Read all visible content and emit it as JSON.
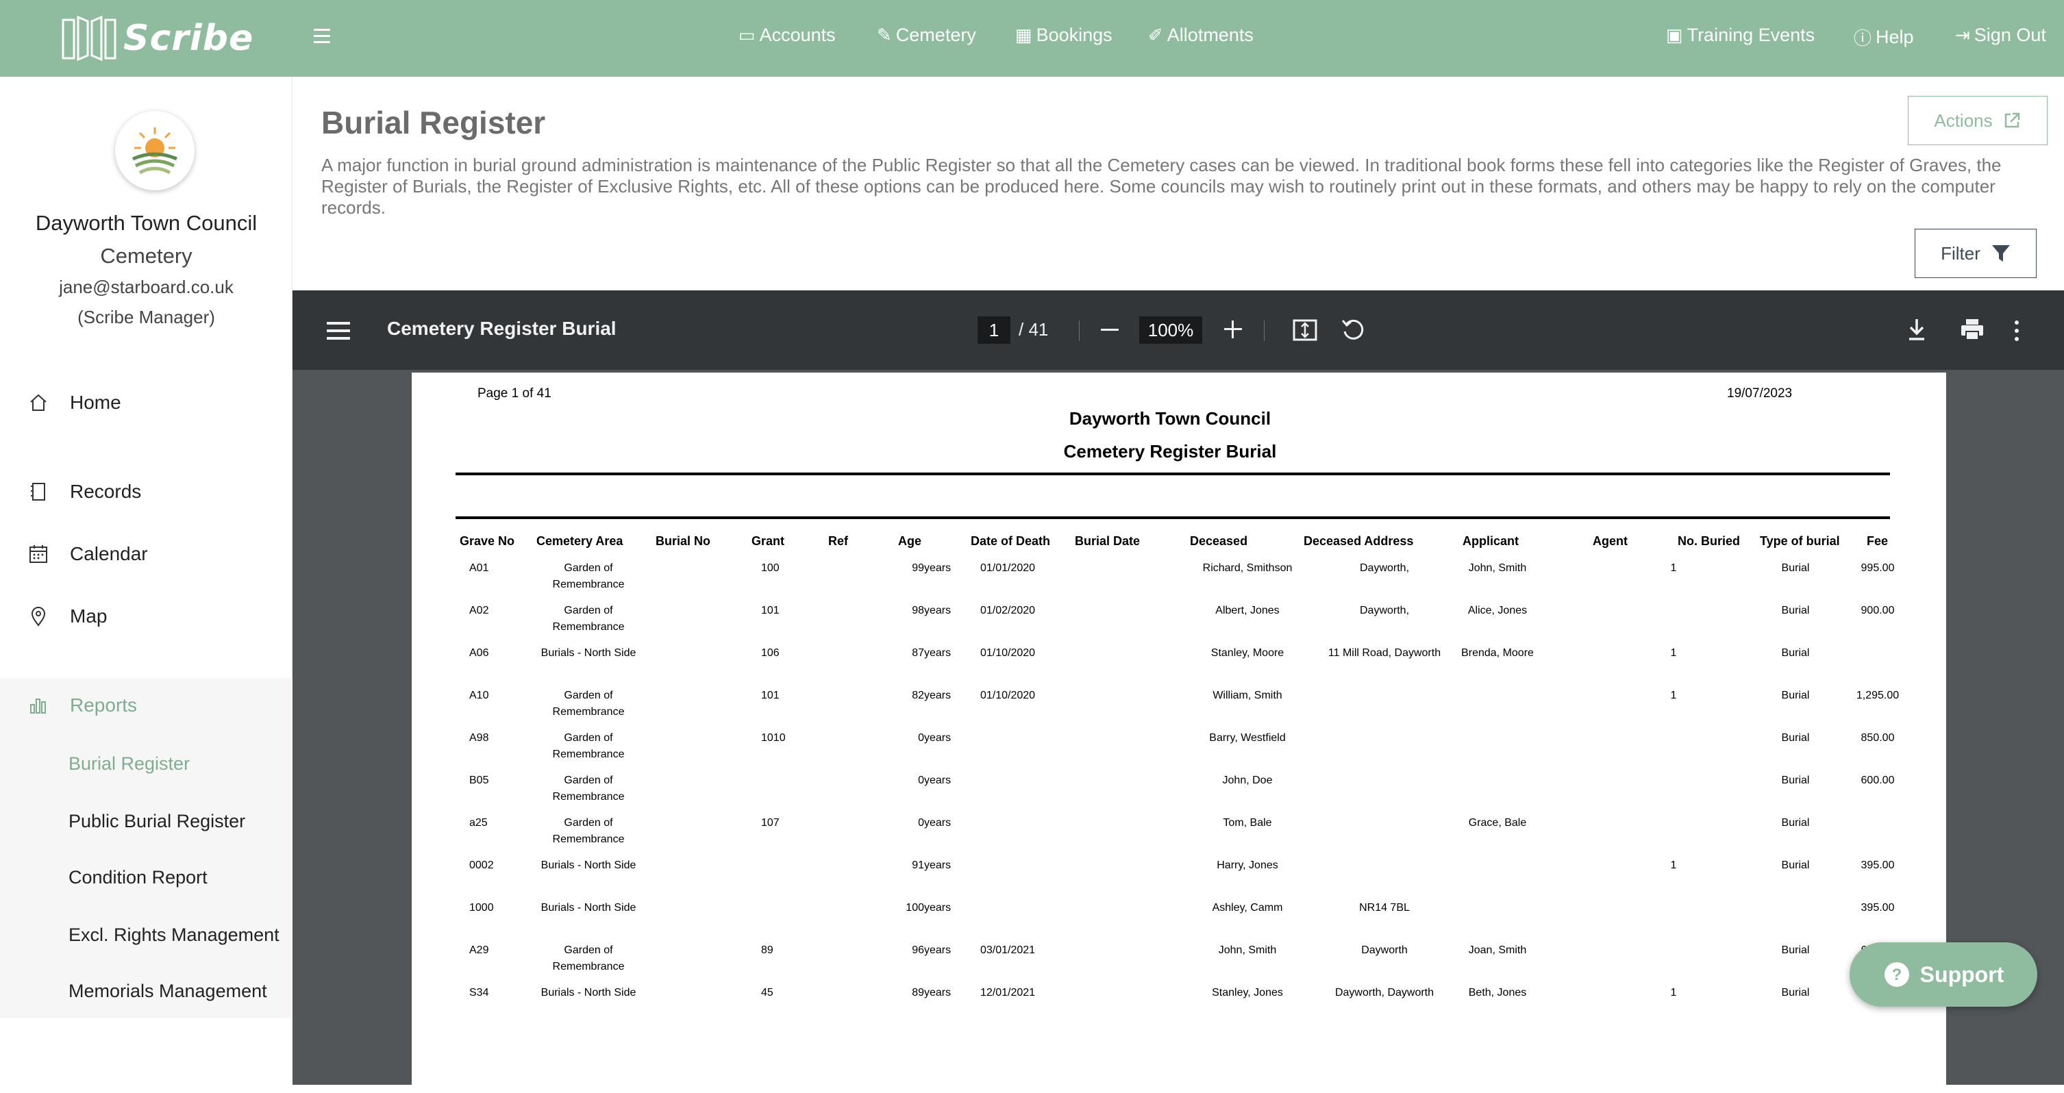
{
  "brand": {
    "name": "Scribe"
  },
  "topnav": {
    "accounts": "Accounts",
    "cemetery": "Cemetery",
    "bookings": "Bookings",
    "allotments": "Allotments",
    "training": "Training Events",
    "help": "Help",
    "signout": "Sign Out"
  },
  "org": {
    "name": "Dayworth Town Council",
    "module": "Cemetery",
    "email": "jane@starboard.co.uk",
    "role": "(Scribe Manager)"
  },
  "sidebar": {
    "home": "Home",
    "records": "Records",
    "calendar": "Calendar",
    "map": "Map",
    "reports": "Reports",
    "sub": [
      "Burial Register",
      "Public Burial Register",
      "Condition Report",
      "Excl. Rights Management",
      "Memorials Management"
    ]
  },
  "page": {
    "title": "Burial Register",
    "description": "A major function in burial ground administration is maintenance of the Public Register so that all the Cemetery cases can be viewed. In traditional book forms these fell into categories like the Register of Graves, the Register of Burials, the Register of Exclusive Rights, etc. All of these options can be produced here. Some councils may wish to routinely print out in these formats, and others may be happy to rely on the computer records.",
    "actions_label": "Actions",
    "filter_label": "Filter"
  },
  "viewer": {
    "title": "Cemetery Register Burial",
    "page_current": "1",
    "page_total": "/ 41",
    "zoom": "100%"
  },
  "report": {
    "page_label": "Page 1 of 41",
    "date": "19/07/2023",
    "title": "Dayworth Town Council",
    "subtitle": "Cemetery Register Burial",
    "columns": [
      "Grave No",
      "Cemetery Area",
      "Burial No",
      "Grant",
      "Ref",
      "Age",
      "Date of Death",
      "Burial Date",
      "Deceased",
      "Deceased Address",
      "Applicant",
      "Agent",
      "No. Buried",
      "Type of burial",
      "Fee"
    ],
    "rows": [
      {
        "grave": "A01",
        "area1": "Garden of",
        "area2": "Remembrance",
        "grant": "100",
        "age": "99",
        "unit": "years",
        "dod": "01/01/2020",
        "deceased": "Richard, Smithson",
        "address": "Dayworth,",
        "applicant": "John, Smith",
        "buried": "1",
        "type": "Burial",
        "fee": "995.00"
      },
      {
        "grave": "A02",
        "area1": "Garden of",
        "area2": "Remembrance",
        "grant": "101",
        "age": "98",
        "unit": "years",
        "dod": "01/02/2020",
        "deceased": "Albert, Jones",
        "address": "Dayworth,",
        "applicant": "Alice, Jones",
        "buried": "",
        "type": "Burial",
        "fee": "900.00"
      },
      {
        "grave": "A06",
        "area1": "Burials - North Side",
        "area2": "",
        "grant": "106",
        "age": "87",
        "unit": "years",
        "dod": "01/10/2020",
        "deceased": "Stanley, Moore",
        "address": "11 Mill Road, Dayworth",
        "applicant": "Brenda, Moore",
        "buried": "1",
        "type": "Burial",
        "fee": ""
      },
      {
        "grave": "A10",
        "area1": "Garden of",
        "area2": "Remembrance",
        "grant": "101",
        "age": "82",
        "unit": "years",
        "dod": "01/10/2020",
        "deceased": "William, Smith",
        "address": "",
        "applicant": "",
        "buried": "1",
        "type": "Burial",
        "fee": "1,295.00"
      },
      {
        "grave": "A98",
        "area1": "Garden of",
        "area2": "Remembrance",
        "grant": "1010",
        "age": "0",
        "unit": "years",
        "dod": "",
        "deceased": "Barry, Westfield",
        "address": "",
        "applicant": "",
        "buried": "",
        "type": "Burial",
        "fee": "850.00"
      },
      {
        "grave": "B05",
        "area1": "Garden of",
        "area2": "Remembrance",
        "grant": "",
        "age": "0",
        "unit": "years",
        "dod": "",
        "deceased": "John, Doe",
        "address": "",
        "applicant": "",
        "buried": "",
        "type": "Burial",
        "fee": "600.00"
      },
      {
        "grave": "a25",
        "area1": "Garden of",
        "area2": "Remembrance",
        "grant": "107",
        "age": "0",
        "unit": "years",
        "dod": "",
        "deceased": "Tom, Bale",
        "address": "",
        "applicant": "Grace, Bale",
        "buried": "",
        "type": "Burial",
        "fee": ""
      },
      {
        "grave": "0002",
        "area1": "Burials - North Side",
        "area2": "",
        "grant": "",
        "age": "91",
        "unit": "years",
        "dod": "",
        "deceased": "Harry, Jones",
        "address": "",
        "applicant": "",
        "buried": "1",
        "type": "Burial",
        "fee": "395.00"
      },
      {
        "grave": "1000",
        "area1": "Burials - North Side",
        "area2": "",
        "grant": "",
        "age": "100",
        "unit": "years",
        "dod": "",
        "deceased": "Ashley, Camm",
        "address": "NR14 7BL",
        "applicant": "",
        "buried": "",
        "type": "",
        "fee": "395.00"
      },
      {
        "grave": "A29",
        "area1": "Garden of",
        "area2": "Remembrance",
        "grant": "89",
        "age": "96",
        "unit": "years",
        "dod": "03/01/2021",
        "deceased": "John, Smith",
        "address": "Dayworth",
        "applicant": "Joan, Smith",
        "buried": "",
        "type": "Burial",
        "fee": "600.00"
      },
      {
        "grave": "S34",
        "area1": "Burials - North Side",
        "area2": "",
        "grant": "45",
        "age": "89",
        "unit": "years",
        "dod": "12/01/2021",
        "deceased": "Stanley, Jones",
        "address": "Dayworth, Dayworth",
        "applicant": "Beth, Jones",
        "buried": "1",
        "type": "Burial",
        "fee": ""
      }
    ]
  },
  "support": {
    "label": "Support"
  },
  "colors": {
    "brand": "#8fbc9e",
    "toolbar": "#323639",
    "viewer_bg": "#525659"
  }
}
